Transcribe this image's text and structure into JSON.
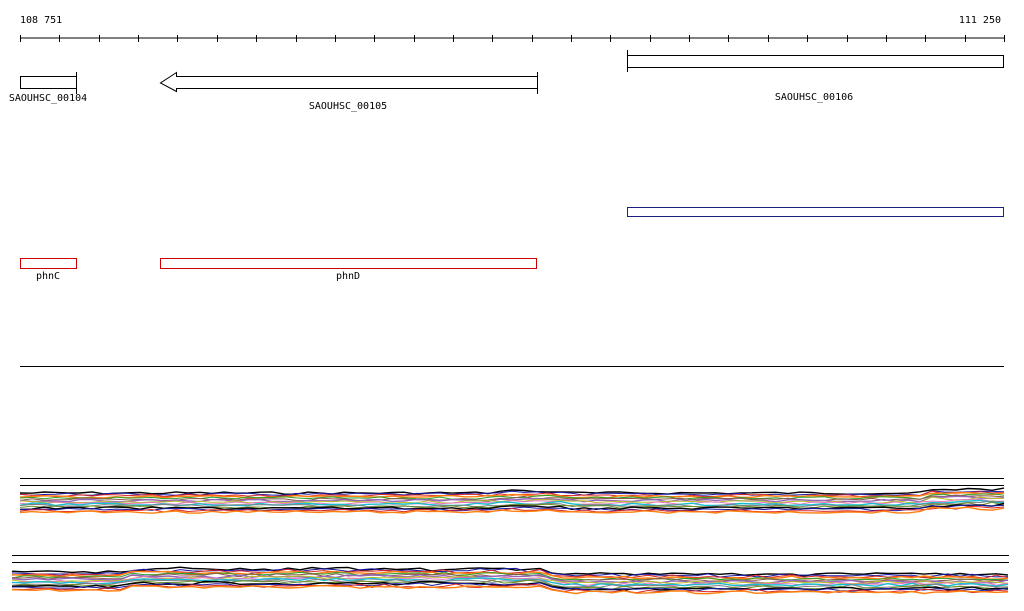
{
  "ruler": {
    "start_label": "108 751",
    "end_label": "111 250"
  },
  "genes": [
    {
      "label": "SAOUHSC_00104",
      "strand": "none",
      "color": "#000000"
    },
    {
      "label": "SAOUHSC_00105",
      "strand": "reverse",
      "color": "#000000"
    },
    {
      "label": "SAOUHSC_00106",
      "strand": "none",
      "color": "#000000"
    }
  ],
  "annotation_features": [
    {
      "label": "",
      "color": "#1a237e"
    }
  ],
  "named_features": [
    {
      "label": "phnC",
      "color": "#cc0000"
    },
    {
      "label": "phnD",
      "color": "#cc0000"
    }
  ],
  "coverage_tracks": [
    {
      "name": "expression-track-1"
    },
    {
      "name": "expression-track-2"
    }
  ],
  "colors": {
    "axis": "#000000",
    "gene_outline": "#000000",
    "feature_outline_red": "#cc0000",
    "feature_outline_blue": "#1a237e",
    "trace_palette": [
      "#000000",
      "#1a1aa6",
      "#d62728",
      "#ff7f0e",
      "#2ca02c",
      "#8c564b",
      "#9467bd",
      "#bcbd22",
      "#e377c2",
      "#17becf",
      "#7f7f7f",
      "#6b8e23"
    ]
  }
}
